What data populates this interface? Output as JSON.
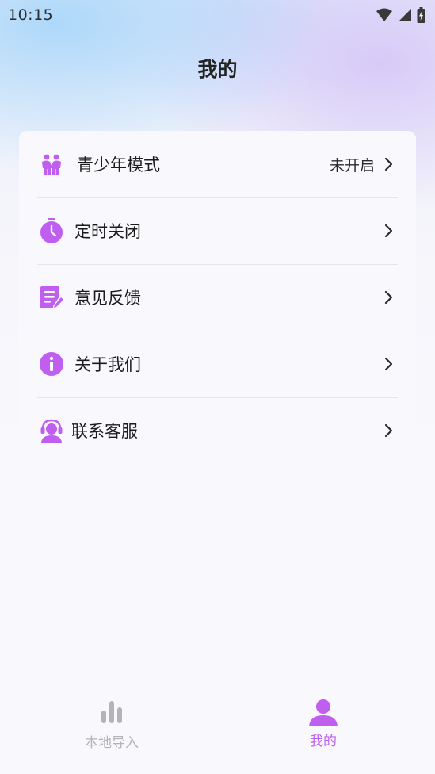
{
  "status_bar": {
    "time": "10:15"
  },
  "header": {
    "title": "我的"
  },
  "menu": [
    {
      "label": "青少年模式",
      "value": "未开启",
      "icon": "teen-mode-icon"
    },
    {
      "label": "定时关闭",
      "value": "",
      "icon": "timer-icon"
    },
    {
      "label": "意见反馈",
      "value": "",
      "icon": "feedback-icon"
    },
    {
      "label": "关于我们",
      "value": "",
      "icon": "info-icon"
    },
    {
      "label": "联系客服",
      "value": "",
      "icon": "customer-service-icon"
    }
  ],
  "tabs": [
    {
      "label": "本地导入",
      "icon": "bar-chart-icon",
      "active": false
    },
    {
      "label": "我的",
      "icon": "person-icon",
      "active": true
    }
  ],
  "colors": {
    "accent": "#c05ef0",
    "inactive": "#b4b4b4",
    "text": "#1c1c1c"
  }
}
